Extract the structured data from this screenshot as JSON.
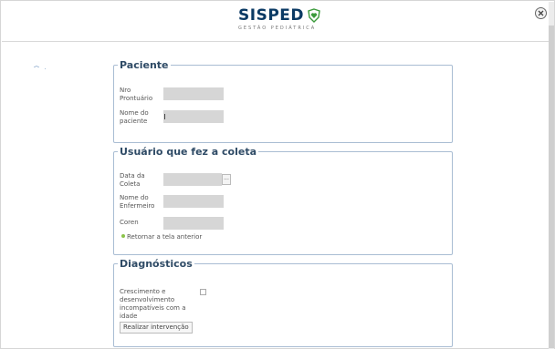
{
  "header": {
    "logo_sis": "SIS",
    "logo_ped": "PED",
    "logo_subtitle": "GESTÃO PEDIÁTRICA"
  },
  "paciente": {
    "title": "Paciente",
    "nro_label": "Nro Prontuário",
    "nome_label": "Nome do paciente",
    "nro_value": "",
    "nome_value": ""
  },
  "usuario": {
    "title": "Usuário que fez a coleta",
    "data_label": "Data da Coleta",
    "enfermeiro_label": "Nome do Enfermeiro",
    "coren_label": "Coren",
    "date_picker_label": "...",
    "back_link": "Retornar a tela anterior"
  },
  "diagnosticos": {
    "title": "Diagnósticos",
    "item_label": "Crescimento e desenvolvimento incompatíveis com a idade",
    "item_checked": false,
    "button_label": "Realizar intervenção"
  },
  "colors": {
    "brand": "#0b3a64",
    "accent_green": "#8bc34a",
    "fieldset_border": "#a9bdd3"
  }
}
